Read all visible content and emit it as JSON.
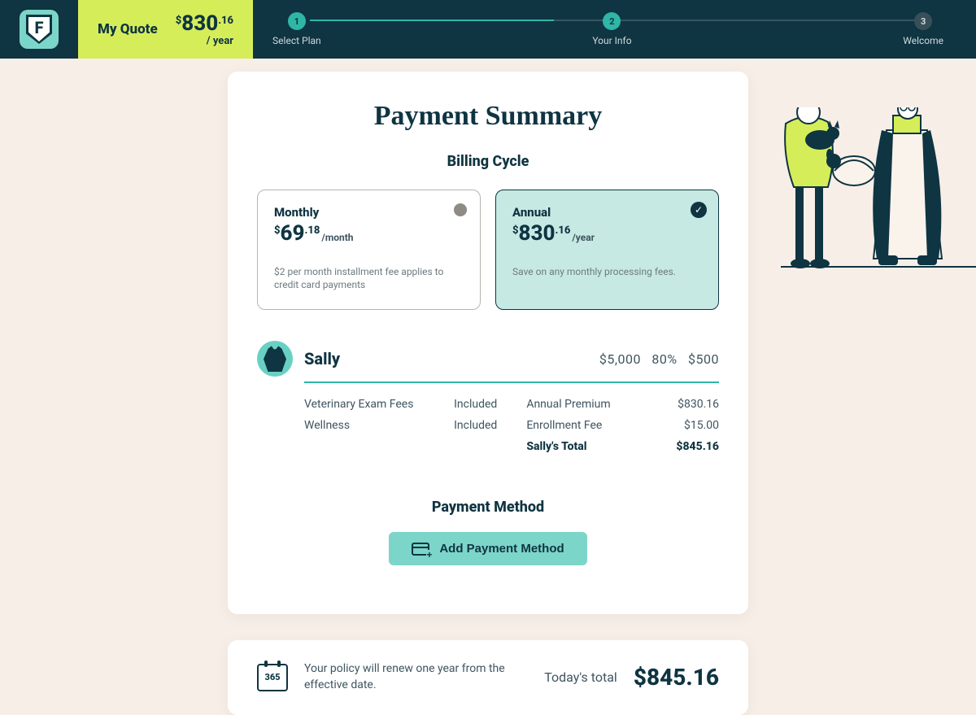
{
  "header": {
    "quote_label": "My Quote",
    "price_dollar": "$",
    "price_big": "830",
    "price_cents": ".16",
    "price_period": "/ year"
  },
  "steps": [
    {
      "num": "1",
      "label": "Select Plan"
    },
    {
      "num": "2",
      "label": "Your Info"
    },
    {
      "num": "3",
      "label": "Welcome"
    }
  ],
  "page_title": "Payment Summary",
  "billing_title": "Billing Cycle",
  "billing": {
    "monthly": {
      "title": "Monthly",
      "big": "69",
      "cents": ".18",
      "period": "/month",
      "note": "$2 per month installment fee applies to credit card payments"
    },
    "annual": {
      "title": "Annual",
      "big": "830",
      "cents": ".16",
      "period": "/year",
      "note": "Save on any monthly processing fees."
    }
  },
  "pet": {
    "name": "Sally",
    "cov_limit": "$5,000",
    "cov_pct": "80%",
    "cov_ded": "$500"
  },
  "details": {
    "vet_label": "Veterinary Exam Fees",
    "vet_value": "Included",
    "well_label": "Wellness",
    "well_value": "Included",
    "prem_label": "Annual Premium",
    "prem_value": "$830.16",
    "enroll_label": "Enrollment Fee",
    "enroll_value": "$15.00",
    "total_label": "Sally's Total",
    "total_value": "$845.16"
  },
  "pm_title": "Payment Method",
  "pm_button": "Add Payment Method",
  "footer": {
    "cal_text": "365",
    "renew_text": "Your policy will renew one year from the effective date.",
    "today_label": "Today's total",
    "today_amount": "$845.16"
  }
}
